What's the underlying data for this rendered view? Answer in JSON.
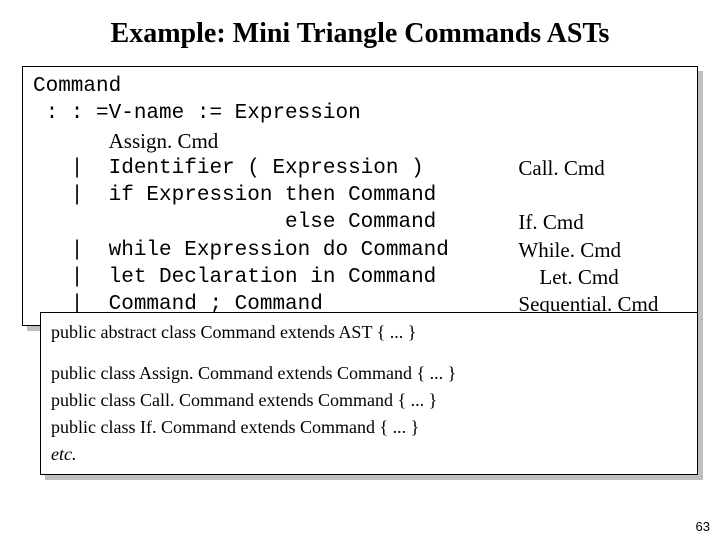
{
  "title": "Example: Mini Triangle Commands ASTs",
  "grammar": {
    "head": "Command",
    "rows": [
      {
        "lhs": " : : =",
        "rhs": "V-name := Expression",
        "label": ""
      },
      {
        "lhs": "",
        "rhs_times": "Assign. Cmd",
        "label": ""
      },
      {
        "lhs": "   |",
        "rhs": "Identifier ( Expression )",
        "label_times": "Call. Cmd"
      },
      {
        "lhs": "   |",
        "rhs": "if Expression then Command",
        "label": ""
      },
      {
        "lhs": "",
        "rhs": "              else Command",
        "label_times": "If. Cmd"
      },
      {
        "lhs": "   |",
        "rhs": "while Expression do Command",
        "label_times": "While. Cmd"
      },
      {
        "lhs": "   |",
        "rhs": "let Declaration in Command",
        "label_times": "    Let. Cmd"
      },
      {
        "lhs": "   |",
        "rhs": "Command ; Command",
        "label_times": "Sequential. Cmd"
      }
    ]
  },
  "code": {
    "line1": "public abstract class Command extends AST { ... }",
    "line2": "public class Assign. Command extends Command { ... }",
    "line3": "public class Call. Command extends Command { ... }",
    "line4": "public class If. Command extends Command { ... }",
    "line5": "etc."
  },
  "page": "63"
}
